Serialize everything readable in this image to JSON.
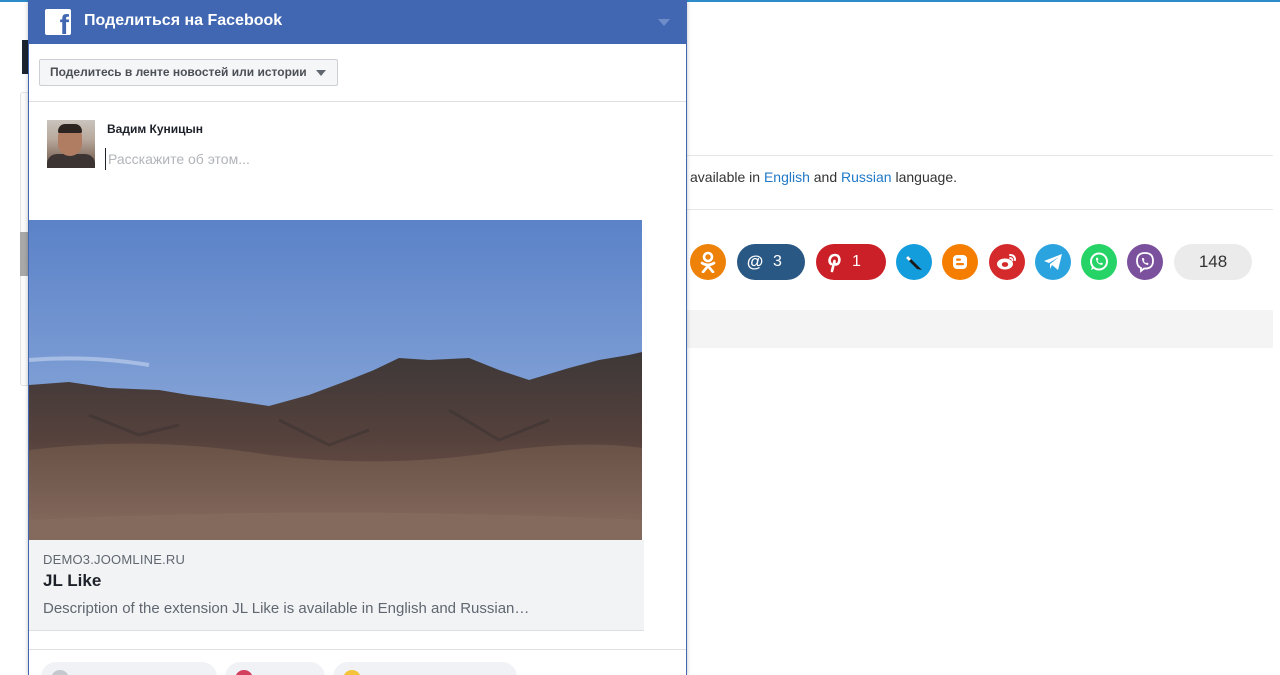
{
  "background": {
    "lang_text_pre": "is available in",
    "lang_link_en": "English",
    "lang_and": "and",
    "lang_link_ru": "Russian",
    "lang_text_post": "language.",
    "share_buttons": [
      {
        "name": "odnoklassniki",
        "color": "#ee8208",
        "glyph": "ok",
        "count": ""
      },
      {
        "name": "mail-ru",
        "color": "#2a5885",
        "glyph": "@",
        "count": "3"
      },
      {
        "name": "pinterest",
        "color": "#cb2027",
        "glyph": "P",
        "count": "1"
      },
      {
        "name": "livejournal",
        "color": "#139ddc",
        "glyph": "✎",
        "count": ""
      },
      {
        "name": "blogger",
        "color": "#f57d00",
        "glyph": "B",
        "count": ""
      },
      {
        "name": "weibo",
        "color": "#d52a2c",
        "glyph": "W",
        "count": ""
      },
      {
        "name": "telegram",
        "color": "#2aa3df",
        "glyph": "➤",
        "count": ""
      },
      {
        "name": "whatsapp",
        "color": "#25d366",
        "glyph": "✆",
        "count": ""
      },
      {
        "name": "viber",
        "color": "#7b519d",
        "glyph": "✆",
        "count": ""
      }
    ],
    "total_count": "148"
  },
  "popup": {
    "title": "Поделиться на Facebook",
    "logo_glyph": "f",
    "destination": "Поделитесь в ленте новостей или истории",
    "user_name": "Вадим Куницын",
    "compose_placeholder": "Расскажите об этом...",
    "preview": {
      "domain": "DEMO3.JOOMLINE.RU",
      "title": "JL Like",
      "description": "Description of the extension JL Like is available in English and Russian…"
    },
    "colors": {
      "header": "#4267b2"
    }
  }
}
